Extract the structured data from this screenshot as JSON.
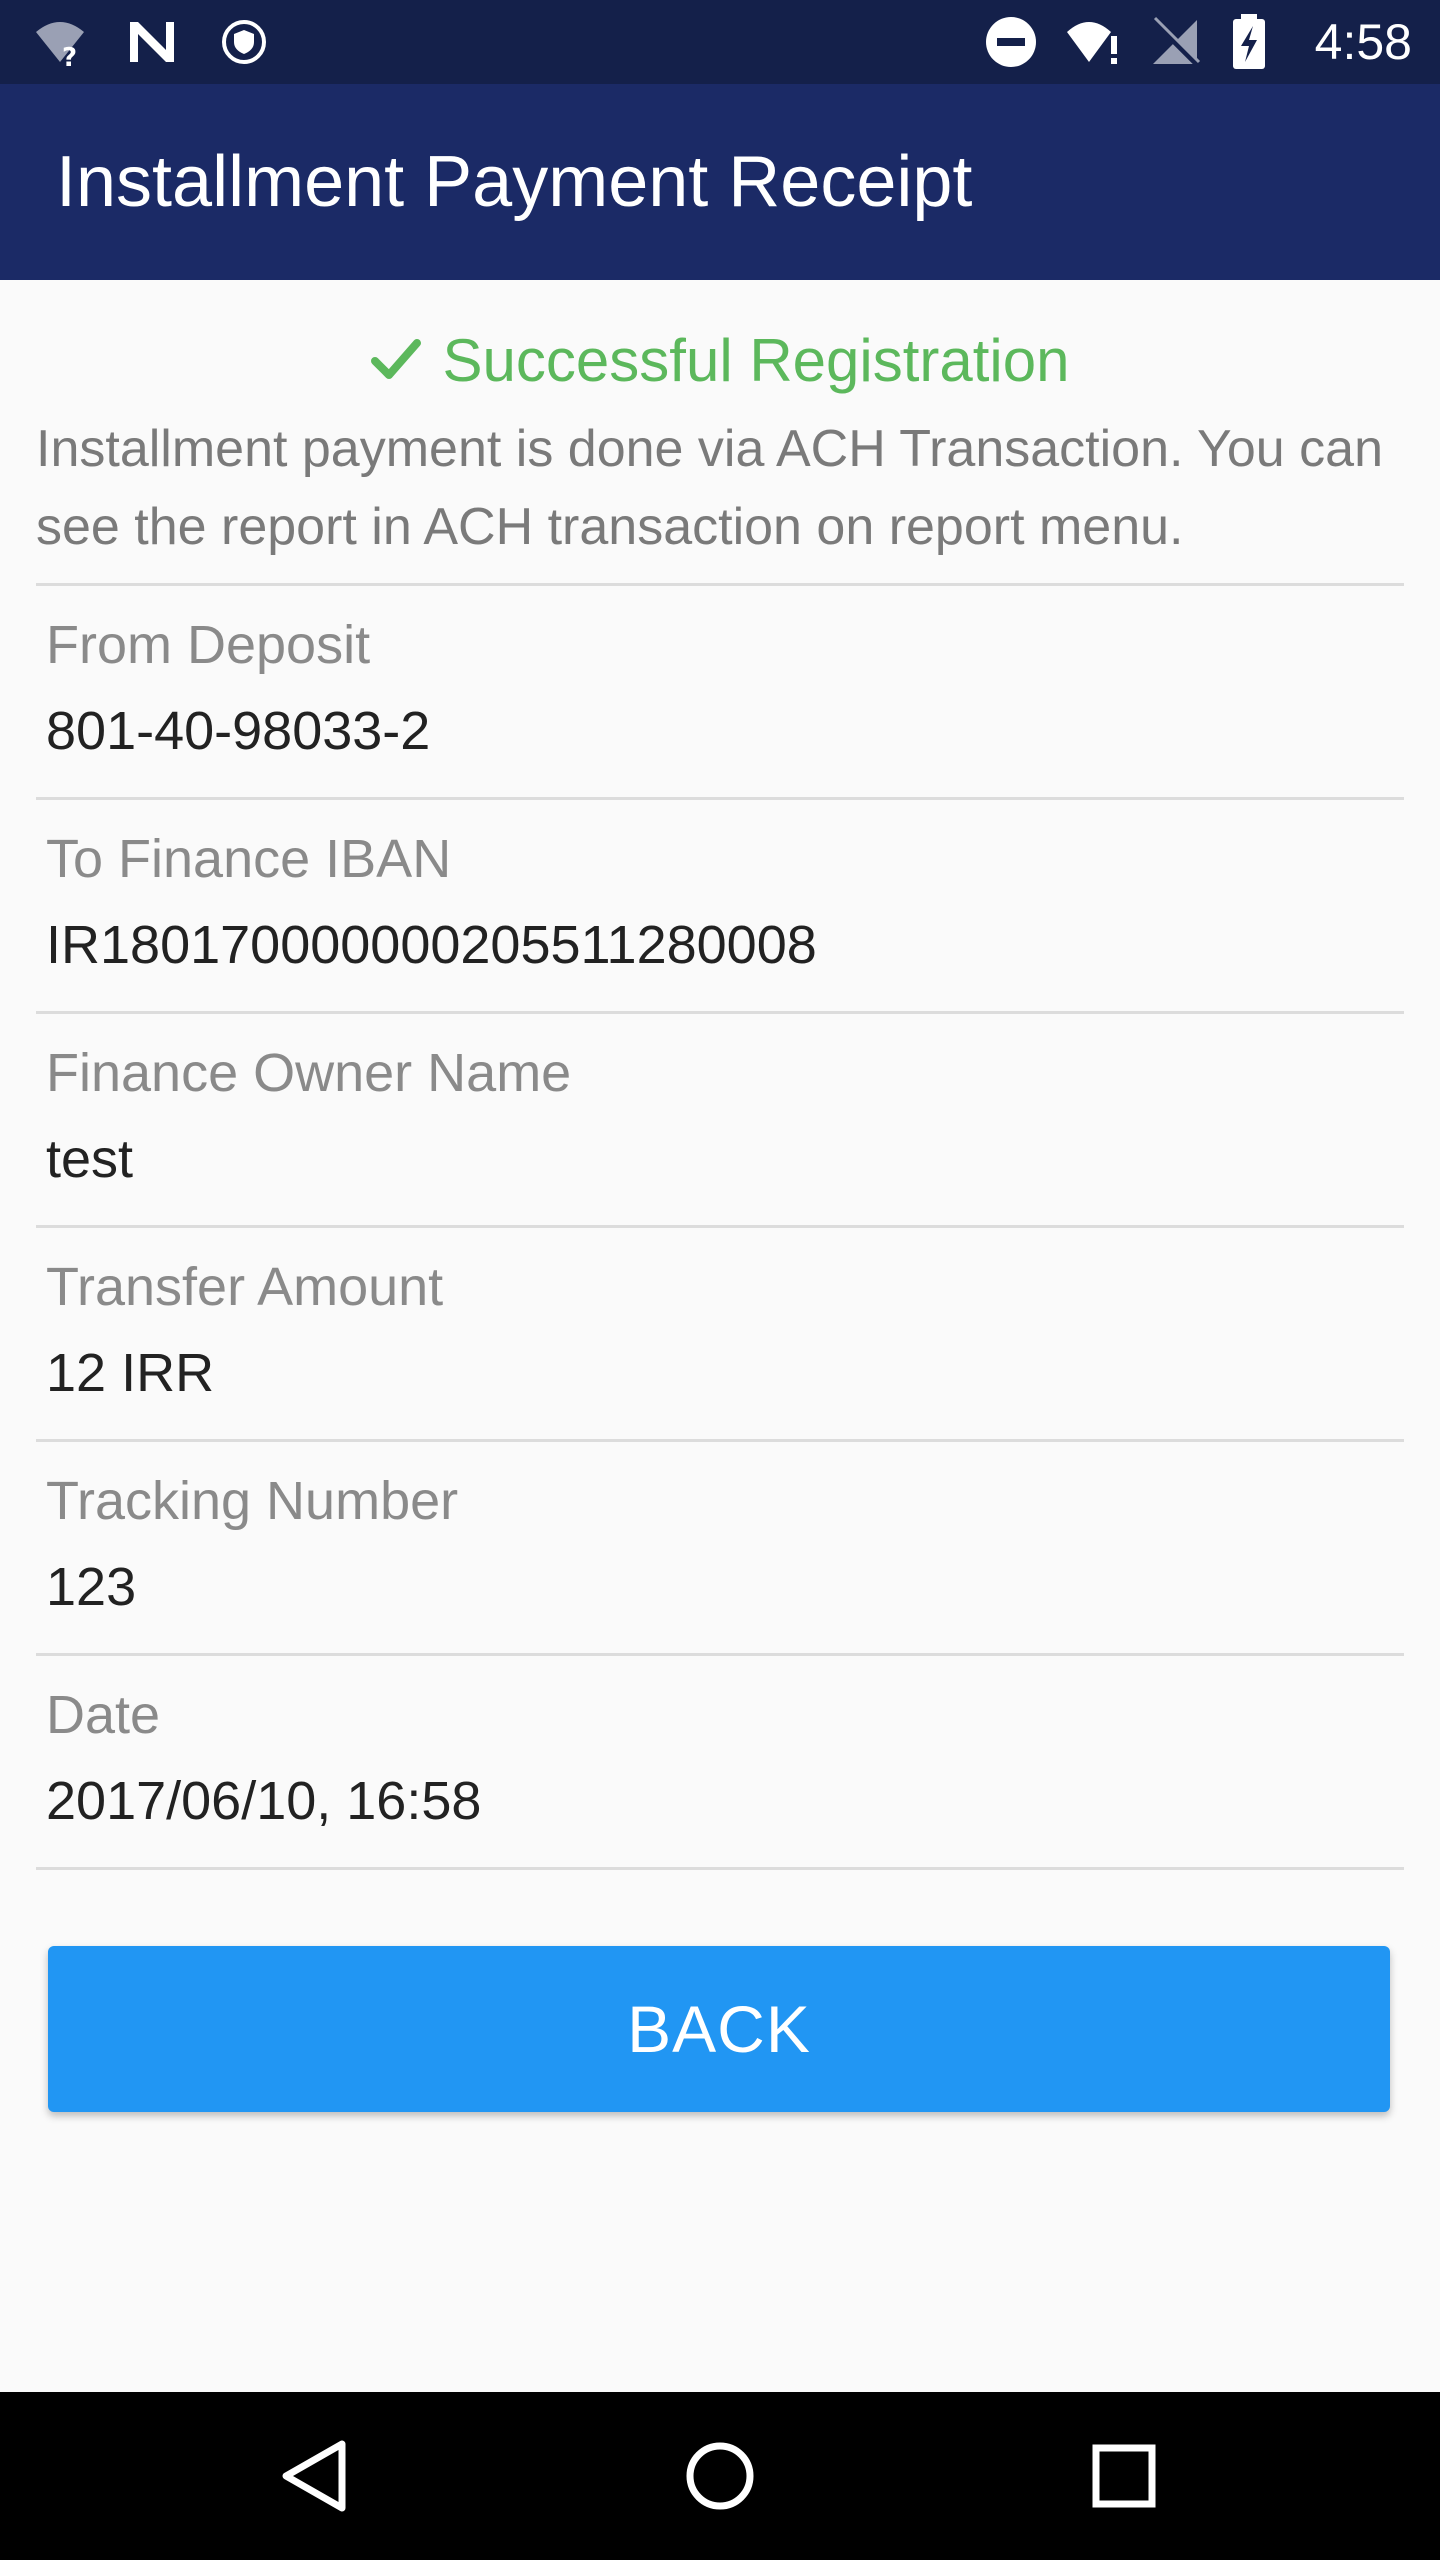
{
  "status_bar": {
    "time": "4:58",
    "left_icons": [
      "wifi-unknown-icon",
      "n-notification-icon",
      "shield-icon"
    ],
    "right_icons": [
      "do-not-disturb-icon",
      "wifi-alert-icon",
      "no-signal-icon",
      "battery-charging-icon"
    ]
  },
  "app_bar": {
    "title": "Installment Payment Receipt",
    "color": "#1b2a66"
  },
  "result": {
    "status": "Successful Registration",
    "status_color": "#5cb85c",
    "message": "Installment payment is done via ACH Transaction. You can see the report in ACH transaction on report menu."
  },
  "details": [
    {
      "label": "From Deposit",
      "value": "801-40-98033-2"
    },
    {
      "label": "To Finance IBAN",
      "value": "IR180170000000205511280008"
    },
    {
      "label": "Finance Owner Name",
      "value": "test"
    },
    {
      "label": "Transfer Amount",
      "value": "12 IRR"
    },
    {
      "label": "Tracking Number",
      "value": "123"
    },
    {
      "label": "Date",
      "value": "2017/06/10, 16:58"
    }
  ],
  "actions": {
    "back_label": "BACK",
    "button_color": "#2196f3"
  },
  "nav_bar": {
    "buttons": [
      "back-triangle-icon",
      "home-circle-icon",
      "recents-square-icon"
    ]
  }
}
